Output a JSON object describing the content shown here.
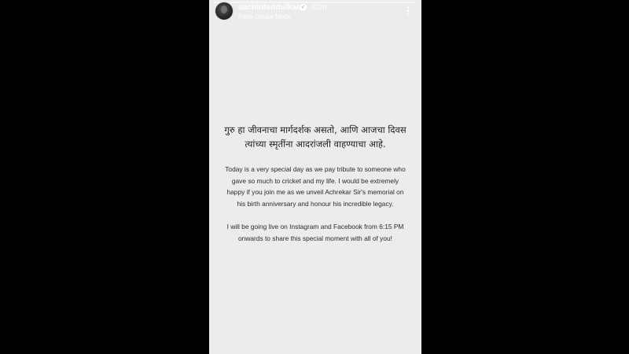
{
  "story": {
    "username": "sachintendulkar",
    "verified_icon": "verified-badge-icon",
    "timestamp": "32m",
    "subtitle": "From Create Mode",
    "more_icon": "more-vertical-icon",
    "background_color": "#ececec",
    "marathi_lines": [
      "गुरु हा जीवनाचा मार्गदर्शक असतो, आणि आजचा दिवस",
      "त्यांच्या स्मृतींना आदरांजली वाहण्याचा आहे."
    ],
    "paragraph1_lines": [
      "Today is a very special day as we pay tribute to someone who",
      "gave so much to cricket and my life. I would be extremely",
      "happy if you join me as we unveil Achrekar Sir's memorial on",
      "his birth anniversary and honour his incredible legacy."
    ],
    "paragraph2_lines": [
      "I will be going live on Instagram and Facebook from 6:15 PM",
      "onwards to share this special moment with all of you!"
    ]
  }
}
